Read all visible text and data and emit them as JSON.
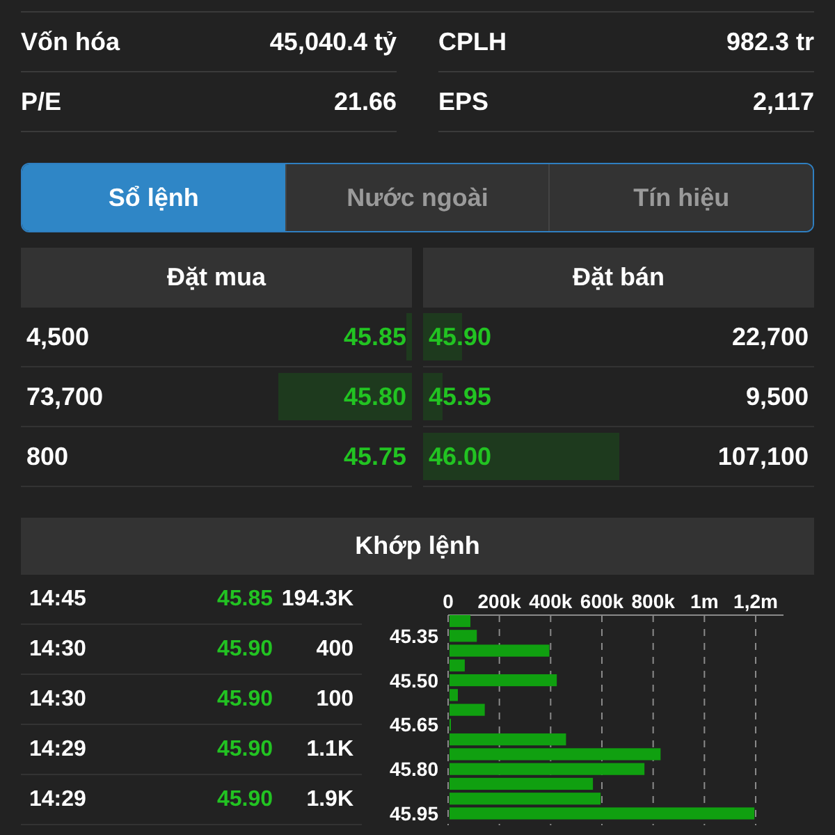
{
  "stats": [
    {
      "label": "Vốn hóa",
      "value": "45,040.4 tỷ"
    },
    {
      "label": "CPLH",
      "value": "982.3 tr"
    },
    {
      "label": "P/E",
      "value": "21.66"
    },
    {
      "label": "EPS",
      "value": "2,117"
    }
  ],
  "tabs": [
    {
      "label": "Sổ lệnh",
      "selected": true
    },
    {
      "label": "Nước ngoài",
      "selected": false
    },
    {
      "label": "Tín hiệu",
      "selected": false
    }
  ],
  "order_book": {
    "bid_header": "Đặt mua",
    "ask_header": "Đặt bán",
    "rows": [
      {
        "bid": {
          "volume": "4,500",
          "price": "45.85",
          "level": 0.015
        },
        "ask": {
          "price": "45.90",
          "volume": "22,700",
          "level": 0.1
        }
      },
      {
        "bid": {
          "volume": "73,700",
          "price": "45.80",
          "level": 0.34
        },
        "ask": {
          "price": "45.95",
          "volume": "9,500",
          "level": 0.05
        }
      },
      {
        "bid": {
          "volume": "800",
          "price": "45.75",
          "level": 0
        },
        "ask": {
          "price": "46.00",
          "volume": "107,100",
          "level": 0.5
        }
      }
    ]
  },
  "matched": {
    "title": "Khớp lệnh",
    "trades": [
      {
        "time": "14:45",
        "price": "45.85",
        "volume": "194.3K"
      },
      {
        "time": "14:30",
        "price": "45.90",
        "volume": "400"
      },
      {
        "time": "14:30",
        "price": "45.90",
        "volume": "100"
      },
      {
        "time": "14:29",
        "price": "45.90",
        "volume": "1.1K"
      },
      {
        "time": "14:29",
        "price": "45.90",
        "volume": "1.9K"
      }
    ],
    "chart_data": {
      "type": "bar",
      "orientation": "horizontal",
      "grid": true,
      "x": [
        45.3,
        45.35,
        45.4,
        45.45,
        45.5,
        45.55,
        45.6,
        45.65,
        45.7,
        45.75,
        45.8,
        45.85,
        45.9,
        45.95
      ],
      "values": [
        87000,
        112000,
        395000,
        65000,
        424000,
        38000,
        143000,
        9000,
        460000,
        829000,
        766000,
        565000,
        595000,
        1195000
      ],
      "xlim": [
        0,
        1200000
      ],
      "ylim": [
        45.99,
        45.28
      ],
      "xticks": [
        {
          "value": 0,
          "label": "0"
        },
        {
          "value": 200000,
          "label": "200k"
        },
        {
          "value": 400000,
          "label": "400k"
        },
        {
          "value": 600000,
          "label": "600k"
        },
        {
          "value": 800000,
          "label": "800k"
        },
        {
          "value": 1000000,
          "label": "1m"
        },
        {
          "value": 1200000,
          "label": "1,2m"
        }
      ],
      "yticks": [
        {
          "value": 45.35,
          "label": "45.35"
        },
        {
          "value": 45.5,
          "label": "45.50"
        },
        {
          "value": 45.65,
          "label": "45.65"
        },
        {
          "value": 45.8,
          "label": "45.80"
        },
        {
          "value": 45.95,
          "label": "45.95"
        }
      ]
    }
  }
}
